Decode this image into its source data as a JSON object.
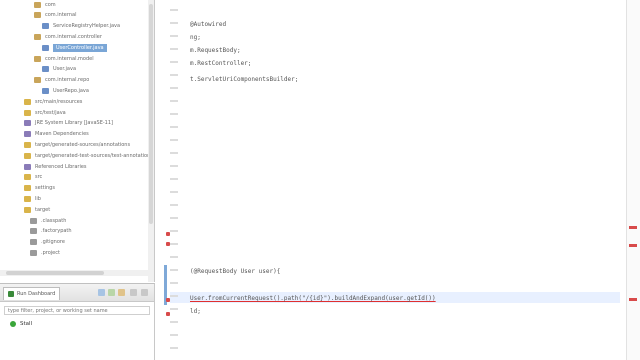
{
  "colors": {
    "selection": "#7aa6d6",
    "error_marker": "#d84a4a",
    "keyword": "#7f0055",
    "string": "#2a00ff",
    "run_icon": "#3aa63a"
  },
  "explorer": {
    "items": [
      {
        "label": "com",
        "icon": "package-icon",
        "color": "#c9a55a"
      },
      {
        "label": "com.internal",
        "icon": "package-icon",
        "color": "#c9a55a"
      },
      {
        "label": "ServiceRegistryHelper.java",
        "icon": "java-file-icon",
        "color": "#6b8fc7"
      },
      {
        "label": "com.internal.controller",
        "icon": "package-icon",
        "color": "#c9a55a"
      },
      {
        "label": "UserController.java",
        "icon": "java-file-icon",
        "color": "#6b8fc7",
        "selected": true
      },
      {
        "label": "com.internal.model",
        "icon": "package-icon",
        "color": "#c9a55a"
      },
      {
        "label": "User.java",
        "icon": "java-file-icon",
        "color": "#6b8fc7"
      },
      {
        "label": "com.internal.repo",
        "icon": "package-icon",
        "color": "#c9a55a"
      },
      {
        "label": "UserRepo.java",
        "icon": "java-file-icon",
        "color": "#6b8fc7"
      },
      {
        "label": "src/main/resources",
        "icon": "folder-icon",
        "color": "#d9b44a"
      },
      {
        "label": "src/test/java",
        "icon": "folder-icon",
        "color": "#d9b44a"
      },
      {
        "label": "JRE System Library [JavaSE-11]",
        "icon": "library-icon",
        "color": "#8a7bb8"
      },
      {
        "label": "Maven Dependencies",
        "icon": "library-icon",
        "color": "#8a7bb8"
      },
      {
        "label": "target/generated-sources/annotations",
        "icon": "folder-icon",
        "color": "#d9b44a"
      },
      {
        "label": "target/generated-test-sources/test-annotations",
        "icon": "folder-icon",
        "color": "#d9b44a"
      },
      {
        "label": "Referenced Libraries",
        "icon": "library-icon",
        "color": "#8a7bb8"
      },
      {
        "label": "src",
        "icon": "folder-icon",
        "color": "#d9b44a"
      },
      {
        "label": "settings",
        "icon": "folder-icon",
        "color": "#d9b44a"
      },
      {
        "label": "lib",
        "icon": "folder-icon",
        "color": "#d9b44a"
      },
      {
        "label": "target",
        "icon": "folder-icon",
        "color": "#d9b44a"
      },
      {
        "label": ".classpath",
        "icon": "file-icon",
        "color": "#9a9a9a"
      },
      {
        "label": ".factorypath",
        "icon": "file-icon",
        "color": "#9a9a9a"
      },
      {
        "label": ".gitignore",
        "icon": "file-icon",
        "color": "#9a9a9a"
      },
      {
        "label": ".project",
        "icon": "file-icon",
        "color": "#9a9a9a"
      }
    ]
  },
  "run_view": {
    "tab_label": "Run Dashboard",
    "filter_placeholder": "type filter, project, or working set name",
    "items": [
      {
        "label": "Stall",
        "icon": "run-icon"
      }
    ]
  },
  "editor": {
    "lines": [
      {
        "num": "",
        "code": ""
      },
      {
        "num": "",
        "code": "@Autowired"
      },
      {
        "num": "",
        "code": "ng;"
      },
      {
        "num": "",
        "code": "m.RequestBody;"
      },
      {
        "num": "",
        "code": "m.RestController;"
      },
      {
        "num": "",
        "code": "t.ServletUriComponentsBuilder;"
      }
    ],
    "method_line": "(@RequestBody User user){",
    "return_line": "User.fromCurrentRequest().path(\"/{id}\").buildAndExpand(user.getId())",
    "closing_line": "ld;"
  }
}
